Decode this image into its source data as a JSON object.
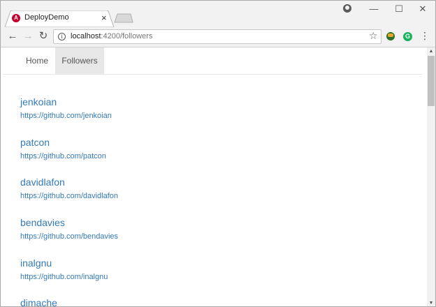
{
  "browser": {
    "tab_title": "DeployDemo",
    "favicon_letter": "A",
    "close_glyph": "×",
    "url_host": "localhost",
    "url_path": ":4200/followers",
    "minimize_glyph": "—",
    "maximize_glyph": "☐",
    "close_window_glyph": "✕",
    "back_glyph": "←",
    "forward_glyph": "→",
    "reload_glyph": "↻",
    "info_glyph": "i",
    "star_glyph": "☆",
    "menu_glyph": "⋮",
    "grammarly_letter": "G"
  },
  "nav": {
    "home": "Home",
    "followers": "Followers",
    "active": "followers"
  },
  "followers": [
    {
      "login": "jenkoian",
      "url": "https://github.com/jenkoian"
    },
    {
      "login": "patcon",
      "url": "https://github.com/patcon"
    },
    {
      "login": "davidlafon",
      "url": "https://github.com/davidlafon"
    },
    {
      "login": "bendavies",
      "url": "https://github.com/bendavies"
    },
    {
      "login": "inalgnu",
      "url": "https://github.com/inalgnu"
    },
    {
      "login": "dimache",
      "url": ""
    }
  ],
  "colors": {
    "link": "#337ab7",
    "nav_active_bg": "#e7e7e7",
    "angular_red": "#c3002f"
  }
}
